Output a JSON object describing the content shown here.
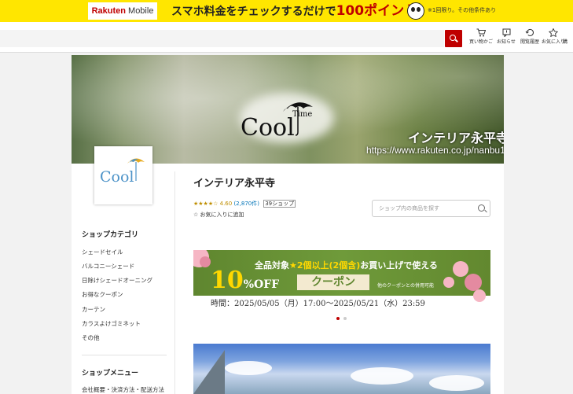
{
  "promo": {
    "brand_main": "Rakuten",
    "brand_sub": "Mobile",
    "headline_pre": "スマホ料金をチェックするだけで",
    "headline_points": "100ポイント",
    "note": "※1回限り。その他条件あり"
  },
  "header": {
    "search_placeholder": "",
    "icons": [
      {
        "icon": "cart-icon",
        "label": "買い物かご"
      },
      {
        "icon": "notice-icon",
        "label": "お知らせ"
      },
      {
        "icon": "history-icon",
        "label": "閲覧履歴"
      },
      {
        "icon": "star-icon",
        "label": "お気に入り"
      },
      {
        "icon": "more-icon",
        "label": "購"
      }
    ]
  },
  "banner": {
    "logo_text": "Cool",
    "logo_small": "Time",
    "title": "インテリア永平寺",
    "url": "https://www.rakuten.co.jp/nanbu1205"
  },
  "shop": {
    "name": "インテリア永平寺",
    "stars": "★★★★☆",
    "rating": "4.60",
    "review_count": "(2,870件)",
    "shop_count": "39ショップ",
    "favorite_label": "お気に入りに追加",
    "search_placeholder": "ショップ内の商品を探す"
  },
  "sidebar": {
    "category_title": "ショップカテゴリ",
    "categories": [
      "シェードセイル",
      "バルコニーシェード",
      "日除けシェードオーニング",
      "お得なクーポン",
      "カーテン",
      "カラスよけゴミネット",
      "その他"
    ],
    "menu_title": "ショップメニュー",
    "menu_items": [
      "会社概要・決済方法・配送方法"
    ]
  },
  "coupon": {
    "top_pre": "全品対象",
    "top_star": "★2個以上(2個含)",
    "top_post": "お買い上げで使える",
    "percent": "10",
    "off": "%OFF",
    "tag": "クーポン",
    "note": "他のクーポンとの併用可能",
    "date": "時間：2025/05/05（月）17:00～2025/05/21（水）23:59"
  },
  "colors": {
    "rakuten_red": "#bf0000",
    "promo_yellow": "#ffe600",
    "coupon_green": "#6f9a3a",
    "coupon_yellow": "#ffd800",
    "rating_gold": "#bf8e00",
    "link_blue": "#0073b7"
  }
}
